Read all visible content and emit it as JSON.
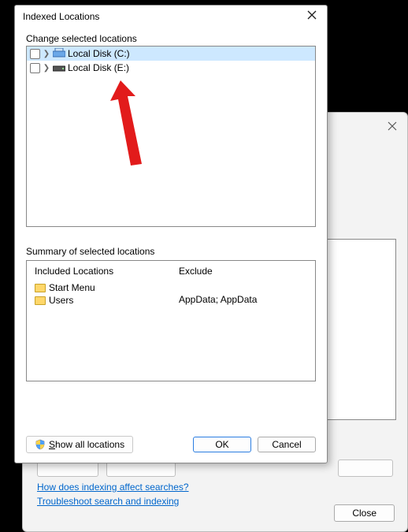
{
  "bg": {
    "link_indexing": "How does indexing affect searches?",
    "link_troubleshoot": "Troubleshoot search and indexing",
    "close_label": "Close"
  },
  "dialog": {
    "title": "Indexed Locations",
    "change_label": "Change selected locations",
    "tree": [
      {
        "label": "Local Disk (C:)",
        "selected": true
      },
      {
        "label": "Local Disk (E:)",
        "selected": false
      }
    ],
    "summary_label": "Summary of selected locations",
    "included_header": "Included Locations",
    "exclude_header": "Exclude",
    "included": [
      "Start Menu",
      "Users"
    ],
    "exclude_text": "AppData; AppData",
    "show_all_label": "Show all locations",
    "ok_label": "OK",
    "cancel_label": "Cancel"
  }
}
